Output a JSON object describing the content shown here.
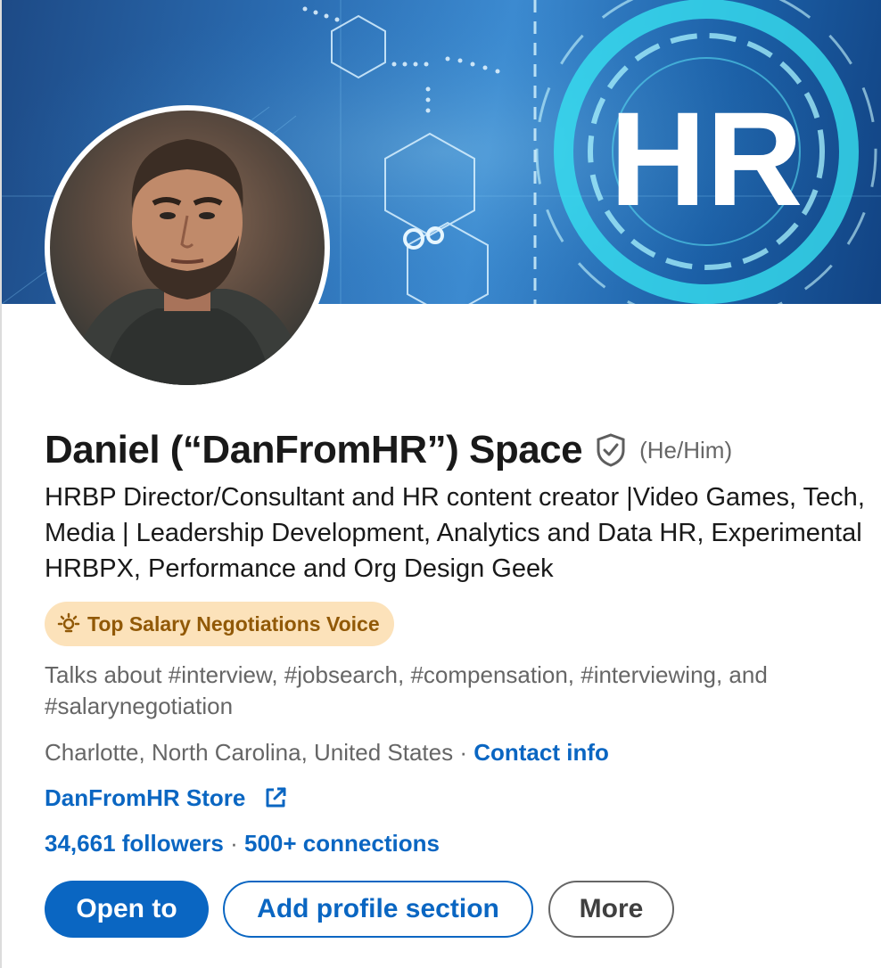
{
  "profile": {
    "name": "Daniel (“DanFromHR”) Space",
    "pronouns": "(He/Him)",
    "headline": "HRBP Director/Consultant and HR content creator |Video Games, Tech, Media | Leadership Development, Analytics and Data HR, Experimental HRBPX, Performance and Org Design Geek",
    "badge": "Top Salary Negotiations Voice",
    "talks_about": "Talks about #interview, #jobsearch, #compensation, #interviewing, and #salarynegotiation",
    "location": "Charlotte, North Carolina, United States",
    "separator": " · ",
    "contact_info": "Contact info",
    "website": "DanFromHR Store",
    "followers": "34,661 followers",
    "connections": "500+ connections"
  },
  "banner": {
    "text": "HR"
  },
  "actions": {
    "open_to": "Open to",
    "add_section": "Add profile section",
    "more": "More"
  },
  "icons": {
    "verified": "shield-check-icon",
    "badge": "lightbulb-icon",
    "external_link": "external-link-icon"
  },
  "colors": {
    "primary": "#0a66c2",
    "badge_bg": "#fce2ba",
    "badge_text": "#915907",
    "secondary_text": "#666666"
  }
}
